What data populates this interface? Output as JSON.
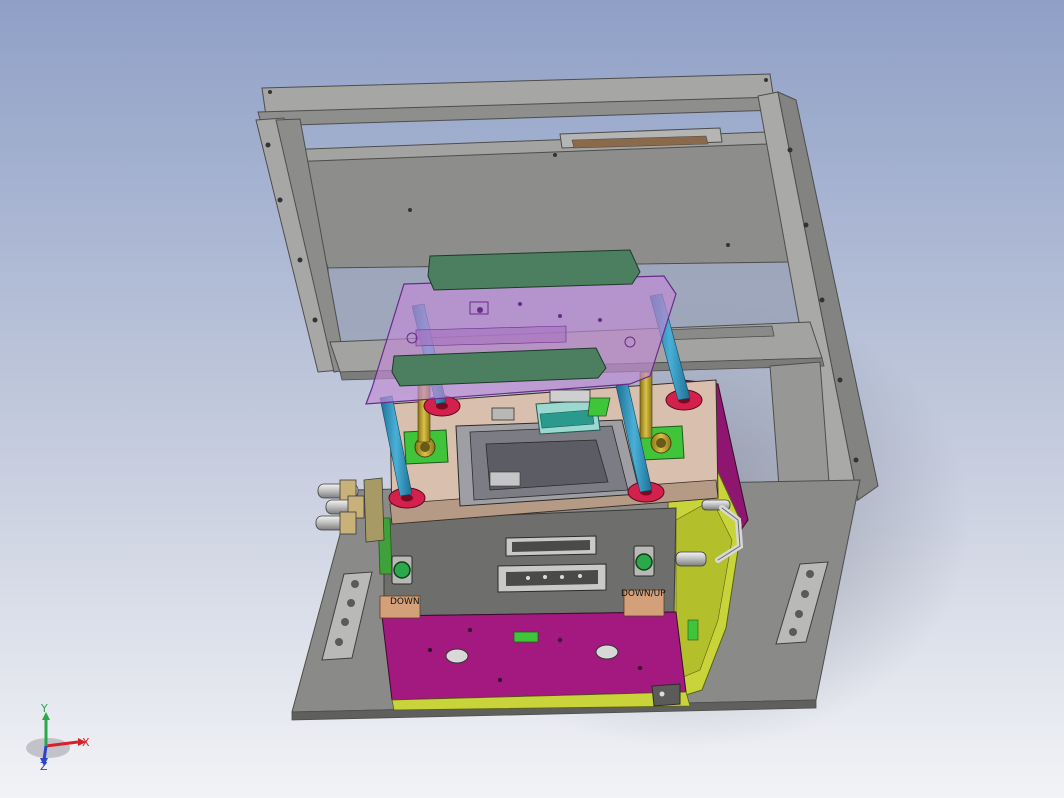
{
  "labels": {
    "down": "DOWN",
    "down_up": "DOWN/UP"
  },
  "triad": {
    "x": "X",
    "y": "Y",
    "z": "Z"
  },
  "colors": {
    "background_top": "#8fa0c7",
    "background_bottom": "#f2f3f6",
    "frame": "#9a9a98",
    "frame_dark": "#6d6d6b",
    "base_plate": "#8a8a88",
    "transparent_plate": "#c18ad6",
    "top_plate": "#d8bfae",
    "magenta_block": "#a3197f",
    "green_pad": "#4c7f60",
    "green_block": "#3fc43a",
    "red_flange": "#d4204d",
    "blue_rod": "#2c8fb8",
    "yellow_green": "#c8d43a",
    "label_plate": "#d4a07a",
    "axis_x": "#d8202a",
    "axis_y": "#2aa84a",
    "axis_z": "#2a44c8"
  }
}
